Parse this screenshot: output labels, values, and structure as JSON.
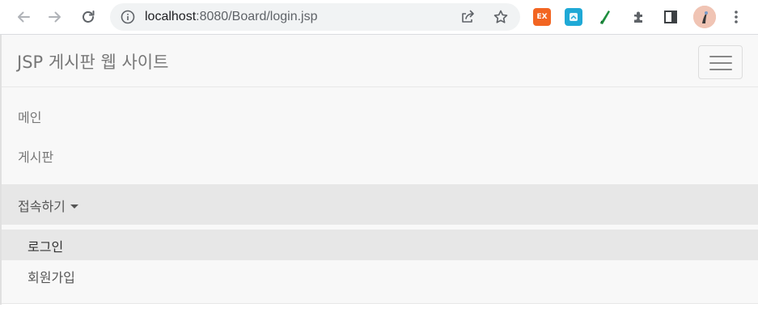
{
  "browser": {
    "url_host": "localhost",
    "url_rest": ":8080/Board/login.jsp",
    "icons": [
      "back-arrow-icon",
      "forward-arrow-icon",
      "reload-icon",
      "info-icon",
      "share-icon",
      "star-icon",
      "puzzle-icon",
      "side-panel-icon",
      "menu-dots-icon"
    ],
    "extensions": [
      {
        "name": "ex-extension",
        "text": "EX",
        "color": "#f26522"
      },
      {
        "name": "translate-extension",
        "color": "#1fa9d6"
      },
      {
        "name": "pen-extension",
        "color": "#1e8e3e"
      }
    ]
  },
  "navbar": {
    "brand": "JSP 게시판 웹 사이트",
    "items": [
      {
        "label": "메인"
      },
      {
        "label": "게시판"
      }
    ],
    "dropdown": {
      "label": "접속하기",
      "items": [
        {
          "label": "로그인",
          "active": true
        },
        {
          "label": "회원가입",
          "active": false
        }
      ]
    }
  },
  "colors": {
    "navbar_bg": "#f8f8f8",
    "active_bg": "#e7e7e7",
    "link": "#777777"
  }
}
